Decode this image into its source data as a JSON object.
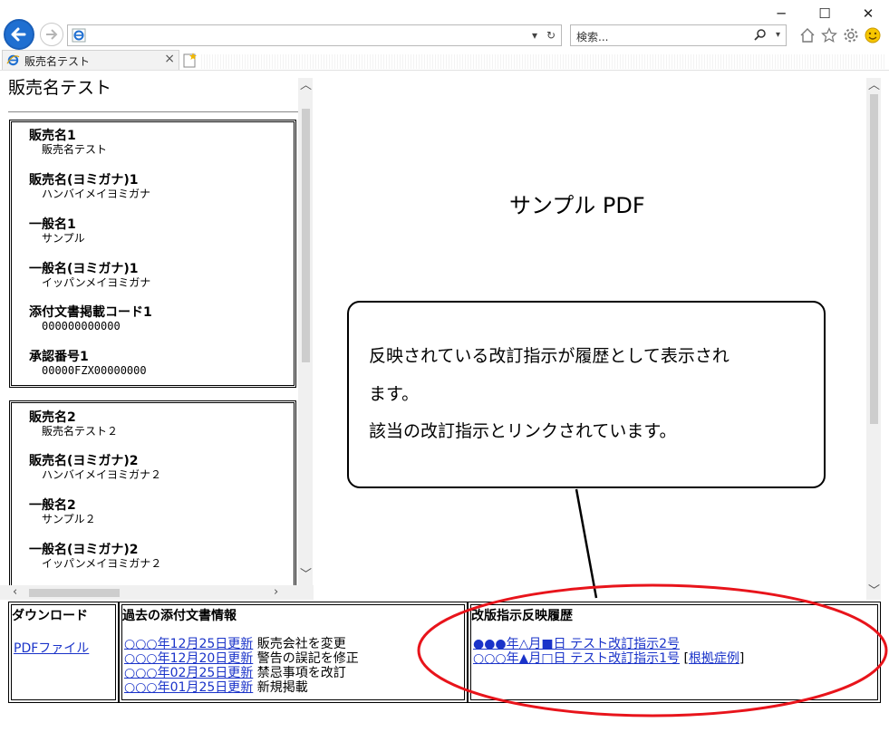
{
  "browser": {
    "search_placeholder": "検索...",
    "tab_title": "販売名テスト",
    "tab_close": "×",
    "window": {
      "minimize": "─",
      "maximize": "☐",
      "close": "✕"
    }
  },
  "left": {
    "title": "販売名テスト",
    "entries": [
      {
        "fields": [
          {
            "label": "販売名1",
            "value": "販売名テスト"
          },
          {
            "label": "販売名(ヨミガナ)1",
            "value": "ハンバイメイヨミガナ"
          },
          {
            "label": "一般名1",
            "value": "サンプル"
          },
          {
            "label": "一般名(ヨミガナ)1",
            "value": "イッパンメイヨミガナ"
          },
          {
            "label": "添付文書掲載コード1",
            "value": "000000000000"
          },
          {
            "label": "承認番号1",
            "value": "00000FZX00000000"
          }
        ]
      },
      {
        "fields": [
          {
            "label": "販売名2",
            "value": "販売名テスト２"
          },
          {
            "label": "販売名(ヨミガナ)2",
            "value": "ハンバイメイヨミガナ２"
          },
          {
            "label": "一般名2",
            "value": "サンプル２"
          },
          {
            "label": "一般名(ヨミガナ)2",
            "value": "イッパンメイヨミガナ２"
          }
        ]
      }
    ]
  },
  "pdf": {
    "title": "サンプル PDF",
    "callout": [
      "反映されている改訂指示が履歴として表示され",
      "ます。",
      "該当の改訂指示とリンクされています。"
    ]
  },
  "bottom": {
    "download": {
      "heading": "ダウンロード",
      "link": "PDFファイル"
    },
    "past": {
      "heading": "過去の添付文書情報",
      "rows": [
        {
          "date": "○○○年12月25日更新",
          "note": "販売会社を変更"
        },
        {
          "date": "○○○年12月20日更新",
          "note": "警告の誤記を修正"
        },
        {
          "date": "○○○年02月25日更新",
          "note": "禁忌事項を改訂"
        },
        {
          "date": "○○○年01月25日更新",
          "note": "新規掲載"
        }
      ]
    },
    "revision": {
      "heading": "改版指示反映履歴",
      "rows": [
        {
          "link": "●●●年△月■日 テスト改訂指示2号",
          "extra": ""
        },
        {
          "link": "○○○年▲月□日 テスト改訂指示1号",
          "extra_open": "[",
          "extra_link": "根拠症例",
          "extra_close": "]"
        }
      ]
    }
  },
  "colors": {
    "link": "#1a33c9",
    "highlight": "#e8141b",
    "ie_blue": "#1f6fd1"
  }
}
